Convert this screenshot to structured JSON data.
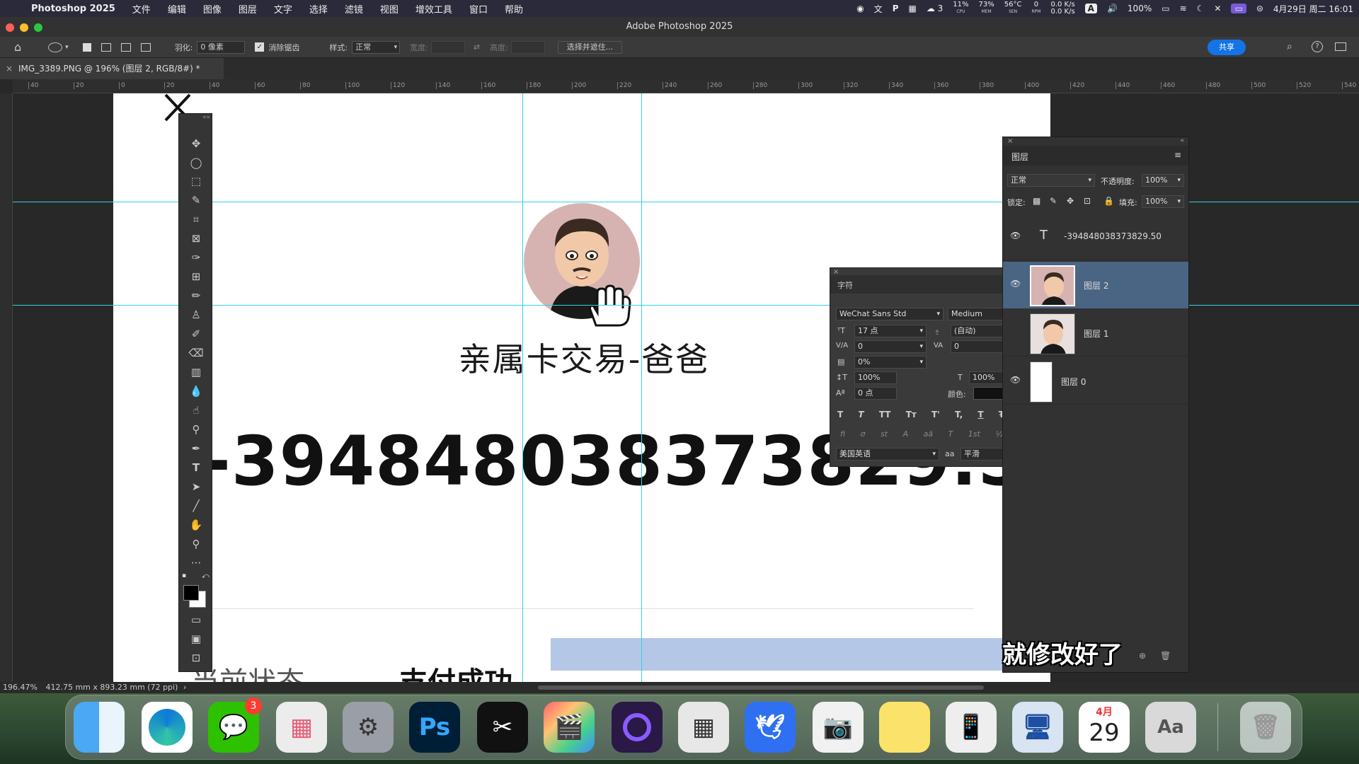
{
  "menubar": {
    "app_name": "Photoshop 2025",
    "items": [
      "文件",
      "编辑",
      "图像",
      "图层",
      "文字",
      "选择",
      "滤镜",
      "视图",
      "增效工具",
      "窗口",
      "帮助"
    ],
    "wechat_count": "3",
    "cpu": "11%",
    "cpu_label": "CPU",
    "mem": "73%",
    "mem_label": "MEM",
    "sen": "56°C",
    "sen_label": "SEN",
    "rpm": "0",
    "rpm_label": "RPM",
    "net_up": "0.0 K/s",
    "net_down": "0.0 K/s",
    "input_badge": "A",
    "battery": "100%",
    "datetime": "4月29日 周二  16:01"
  },
  "titlebar": {
    "title": "Adobe Photoshop 2025"
  },
  "options": {
    "feather_label": "羽化:",
    "feather_value": "0 像素",
    "antialias_label": "消除锯齿",
    "style_label": "样式:",
    "style_value": "正常",
    "width_label": "宽度:",
    "height_label": "高度:",
    "select_mask_button": "选择并遮住...",
    "share_button": "共享"
  },
  "document": {
    "tab_title": "IMG_3389.PNG @ 196% (图层 2, RGB/8#) *"
  },
  "ruler": {
    "h_ticks": [
      "40",
      "20",
      "0",
      "20",
      "40",
      "60",
      "80",
      "100",
      "120",
      "140",
      "160",
      "180",
      "200",
      "220",
      "240",
      "260",
      "280",
      "300",
      "320",
      "340",
      "360",
      "380",
      "400",
      "420",
      "440",
      "460",
      "480",
      "500",
      "520",
      "540"
    ]
  },
  "canvas": {
    "heading": "亲属卡交易-爸爸",
    "amount": "-394848038373829.50",
    "bottom_left_text": "当前状态",
    "bottom_right_text": "支付成功"
  },
  "subtitle": "就修改好了",
  "character_panel": {
    "title": "字符",
    "font_family": "WeChat Sans Std",
    "font_style": "Medium",
    "font_size": "17 点",
    "leading": "(自动)",
    "kerning": "0",
    "tracking": "0",
    "tsume": "0%",
    "vscale": "100%",
    "hscale": "100%",
    "baseline": "0 点",
    "color_label": "颜色:",
    "language": "美国英语",
    "aa_label": "aa",
    "aa_value": "平滑",
    "style_buttons": [
      "T",
      "T",
      "TT",
      "Tт",
      "T'",
      "T,",
      "T",
      "Ŧ"
    ],
    "ot_buttons": [
      "fi",
      "σ",
      "st",
      "A",
      "aā",
      "T",
      "1st",
      "½"
    ]
  },
  "layers_panel": {
    "title": "图层",
    "blend_mode": "正常",
    "opacity_label": "不透明度:",
    "opacity": "100%",
    "lock_label": "锁定:",
    "fill_label": "填充:",
    "fill": "100%",
    "layers": [
      {
        "name": "-394848038373829.50",
        "type": "text",
        "visible": true
      },
      {
        "name": "图层 2",
        "type": "image",
        "visible": true,
        "selected": true
      },
      {
        "name": "图层 1",
        "type": "image",
        "visible": false
      },
      {
        "name": "图层 0",
        "type": "image",
        "visible": true
      }
    ]
  },
  "status": {
    "zoom": "196.47%",
    "doc_info": "412.75 mm x 893.23 mm (72 ppi)"
  },
  "dock": {
    "apps": [
      "Finder",
      "Edge",
      "WeChat",
      "Launchpad",
      "System Settings",
      "Photoshop",
      "CapCut",
      "Final Cut Pro",
      "Screen Recorder",
      "Calculator",
      "Feishu",
      "Screenshot",
      "Notes",
      "Mirror",
      "Remote Desktop",
      "Calendar",
      "Dictionary",
      "Trash"
    ],
    "wechat_badge": "3",
    "calendar_month": "4月",
    "calendar_day": "29",
    "ps_label": "Ps"
  },
  "colors": {
    "guide": "#34d3e0",
    "selected_layer": "#4a6484",
    "share_button": "#1473e6"
  }
}
